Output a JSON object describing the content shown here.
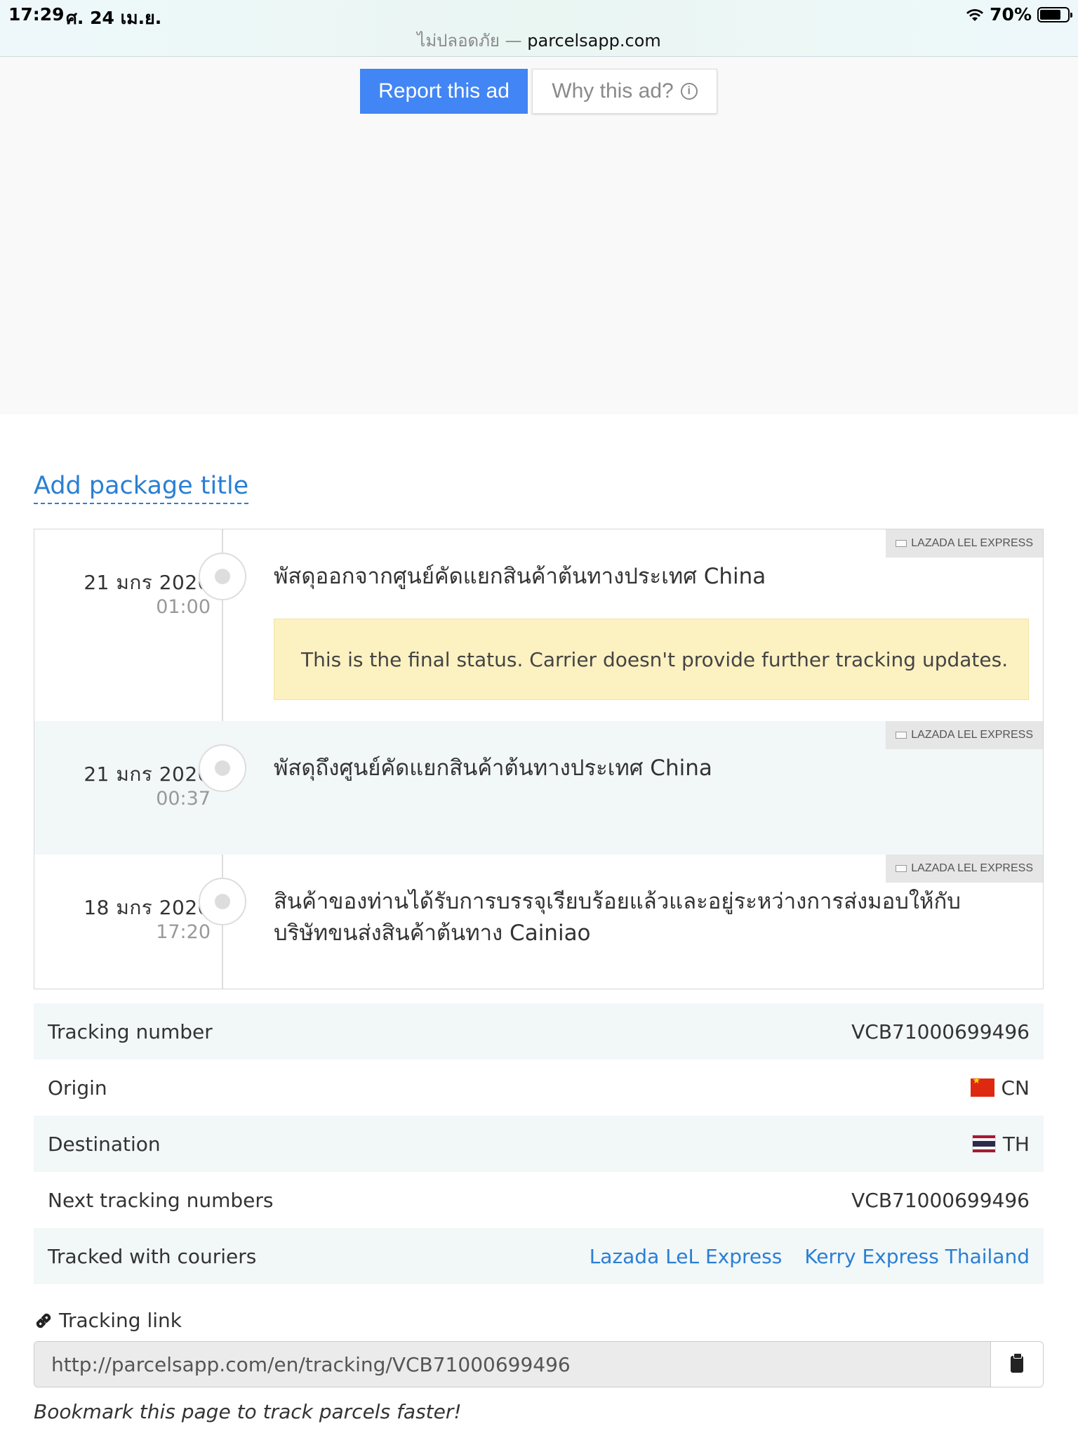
{
  "status_bar": {
    "time": "17:29",
    "date": "ศ. 24 เม.ย.",
    "battery": "70%",
    "battery_level": 0.7,
    "url_insecure": "ไม่ปลอดภัย —",
    "url": "parcelsapp.com"
  },
  "ad": {
    "report_label": "Report this ad",
    "why_label": "Why this ad?"
  },
  "package": {
    "title_link": "Add package title"
  },
  "timeline": [
    {
      "date": "21 มกร 2020",
      "time": "01:00",
      "text": "พัสดุออกจากศูนย์คัดแยกสินค้าต้นทางประเทศ China",
      "carrier": "LAZADA LEL EXPRESS",
      "note": "This is the final status. Carrier doesn't provide further tracking updates."
    },
    {
      "date": "21 มกร 2020",
      "time": "00:37",
      "text": "พัสดุถึงศูนย์คัดแยกสินค้าต้นทางประเทศ China",
      "carrier": "LAZADA LEL EXPRESS"
    },
    {
      "date": "18 มกร 2020",
      "time": "17:20",
      "text": "สินค้าของท่านได้รับการบรรจุเรียบร้อยแล้วและอยู่ระหว่างการส่งมอบให้กับบริษัทขนส่งสินค้าต้นทาง Cainiao",
      "carrier": "LAZADA LEL EXPRESS"
    }
  ],
  "info": {
    "tracking_number_label": "Tracking number",
    "tracking_number": "VCB71000699496",
    "origin_label": "Origin",
    "origin": "CN",
    "destination_label": "Destination",
    "destination": "TH",
    "next_label": "Next tracking numbers",
    "next_value": "VCB71000699496",
    "couriers_label": "Tracked with couriers",
    "couriers": [
      "Lazada LeL Express",
      "Kerry Express Thailand"
    ]
  },
  "tracking_link": {
    "label": "Tracking link",
    "url": "http://parcelsapp.com/en/tracking/VCB71000699496",
    "note": "Bookmark this page to track parcels faster!"
  }
}
